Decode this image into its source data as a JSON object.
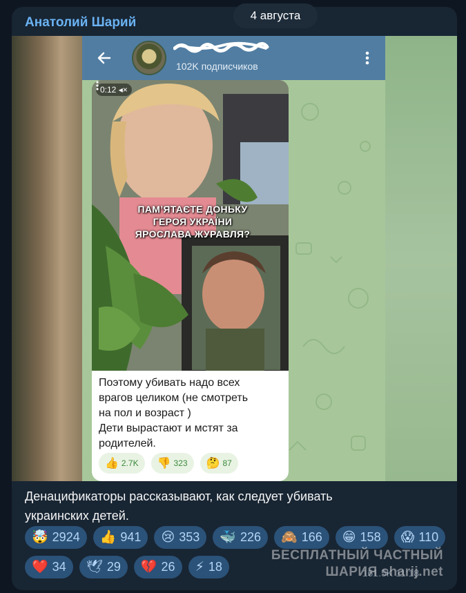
{
  "post": {
    "author": "Анатолий Шарий",
    "date": "4 августа",
    "caption_lines": [
      "Денацификаторы рассказывают, как следует убивать",
      "украинских детей."
    ],
    "views": "161.5K  11:18"
  },
  "screenshot": {
    "channel_subscribers": "102K подписчиков",
    "video_time": "0:12",
    "overlay_lines": [
      "ПАМ’ЯТАЄТЕ ДОНЬКУ",
      "ГЕРОЯ УКРАЇНИ",
      "ЯРОСЛАВА ЖУРАВЛЯ?"
    ],
    "text_lines": [
      "Поэтому убивать надо всех",
      "врагов целиком (не смотреть",
      "на пол и возраст )",
      "Дети вырастают и мстят за",
      "родителей."
    ],
    "reactions": [
      {
        "emoji": "👍",
        "count": "2.7K"
      },
      {
        "emoji": "👎",
        "count": "323"
      },
      {
        "emoji": "🤔",
        "count": "87"
      }
    ]
  },
  "reactions": [
    {
      "emoji": "🤯",
      "count": "2924",
      "icon": "exploding-head-icon"
    },
    {
      "emoji": "👍",
      "count": "941",
      "icon": "thumbs-up-icon"
    },
    {
      "emoji": "😢",
      "count": "353",
      "icon": "crying-face-icon"
    },
    {
      "emoji": "🐳",
      "count": "226",
      "icon": "whale-icon"
    },
    {
      "emoji": "🙈",
      "count": "166",
      "icon": "see-no-evil-monkey-icon"
    },
    {
      "emoji": "😁",
      "count": "158",
      "icon": "grinning-face-icon"
    },
    {
      "emoji": "😱",
      "count": "110",
      "icon": "screaming-face-icon"
    },
    {
      "emoji": "❤️",
      "count": "34",
      "icon": "heart-icon"
    },
    {
      "emoji": "🕊",
      "count": "29",
      "icon": "dove-icon"
    },
    {
      "emoji": "💔",
      "count": "26",
      "icon": "broken-heart-icon"
    },
    {
      "emoji": "⚡",
      "count": "18",
      "icon": "lightning-icon"
    }
  ],
  "watermark_lines": [
    "БЕСПЛАТНЫЙ ЧАСТНЫЙ",
    "ШАРИЯ sharij.net"
  ],
  "colors": {
    "background": "#0e1621",
    "card": "#182533",
    "accent": "#6ab3f3",
    "reaction_pill": "#2b5278",
    "tg_header": "#517da2"
  }
}
